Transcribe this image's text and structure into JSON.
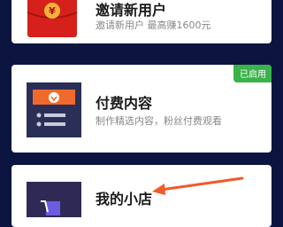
{
  "cards": [
    {
      "title": "邀请新用户",
      "desc": "邀请新用户 最高赚1600元"
    },
    {
      "title": "付费内容",
      "desc": "制作精选内容，粉丝付费观看",
      "badge": "已启用"
    },
    {
      "title": "我的小店"
    }
  ],
  "icons": {
    "card0": "red-envelope-yen-icon",
    "card1": "paid-content-heart-tag-icon",
    "card2": "shopping-cart-icon",
    "annotation": "orange-arrow-annotation"
  },
  "colors": {
    "page_bg": "#0c1540",
    "card_bg": "#ffffff",
    "badge": "#39b34a",
    "envelope": "#d6201c",
    "paid_icon_bg": "#2b2e57",
    "paid_icon_accent": "#f16a2b",
    "shop_icon_bg": "#2f2a55",
    "arrow": "#f15a2b"
  }
}
